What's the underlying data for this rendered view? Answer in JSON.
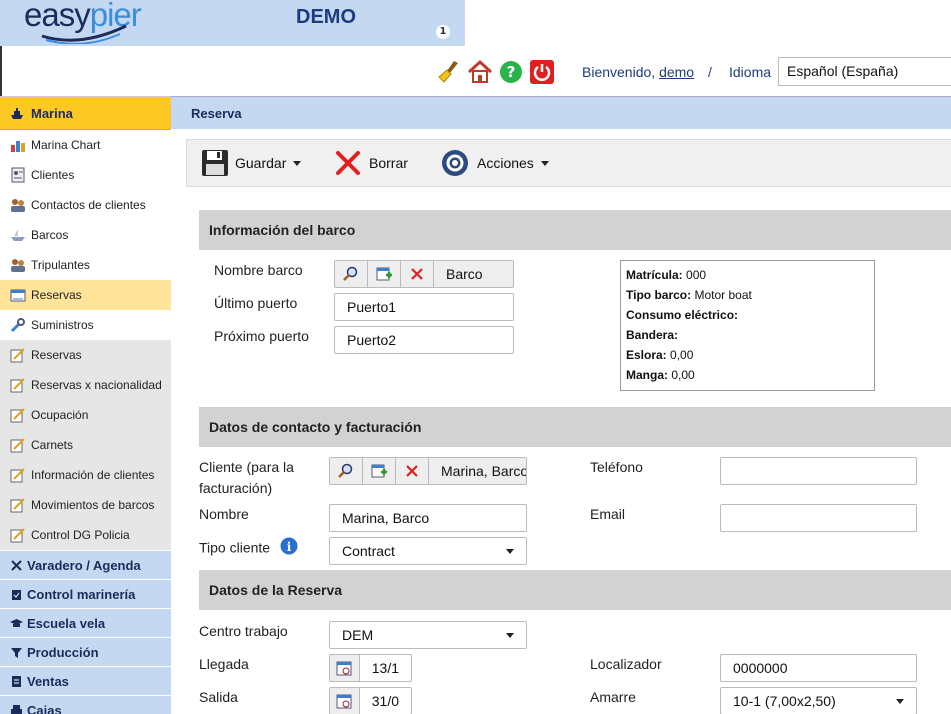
{
  "header": {
    "logo_easy": "easy",
    "logo_pier": "pier",
    "title": "DEMO",
    "notification_count": "1",
    "welcome_text": "Bienvenido, ",
    "username": "demo",
    "separator": "/",
    "language_label": "Idioma",
    "language_value": "Español (España)"
  },
  "sidebar": {
    "head": "Marina",
    "items": [
      {
        "label": "Marina Chart",
        "icon": "chart-icon"
      },
      {
        "label": "Clientes",
        "icon": "clients-icon"
      },
      {
        "label": "Contactos de clientes",
        "icon": "contacts-icon"
      },
      {
        "label": "Barcos",
        "icon": "boat-icon"
      },
      {
        "label": "Tripulantes",
        "icon": "crew-icon"
      },
      {
        "label": "Reservas",
        "icon": "reservations-icon"
      },
      {
        "label": "Suministros",
        "icon": "supplies-icon"
      }
    ],
    "reports": [
      {
        "label": "Reservas"
      },
      {
        "label": "Reservas x nacionalidad"
      },
      {
        "label": "Ocupación"
      },
      {
        "label": "Carnets"
      },
      {
        "label": "Información de clientes"
      },
      {
        "label": "Movimientos de barcos"
      },
      {
        "label": "Control DG Policia"
      }
    ],
    "groups": [
      {
        "label": "Varadero / Agenda",
        "icon": "tools-icon"
      },
      {
        "label": "Control marinería",
        "icon": "clipboard-icon"
      },
      {
        "label": "Escuela vela",
        "icon": "graduation-icon"
      },
      {
        "label": "Producción",
        "icon": "filter-icon"
      },
      {
        "label": "Ventas",
        "icon": "document-icon"
      },
      {
        "label": "Cajas",
        "icon": "register-icon"
      }
    ]
  },
  "tab": {
    "label": "Reserva"
  },
  "toolbar": {
    "save_label": "Guardar",
    "delete_label": "Borrar",
    "actions_label": "Acciones"
  },
  "boat_section": {
    "title": "Información del barco",
    "boat_name_label": "Nombre barco",
    "boat_name_value": "Barco",
    "last_port_label": "Último puerto",
    "last_port_value": "Puerto1",
    "next_port_label": "Próximo puerto",
    "next_port_value": "Puerto2",
    "info": {
      "registration_label": "Matrícula:",
      "registration_value": "000",
      "type_label": "Tipo barco:",
      "type_value": "Motor boat",
      "power_label": "Consumo eléctrico:",
      "power_value": "",
      "flag_label": "Bandera:",
      "flag_value": "",
      "beam_label": "Eslora:",
      "beam_value": "0,00",
      "length_label": "Manga:",
      "length_value": "0,00"
    }
  },
  "contact_section": {
    "title": "Datos de contacto y facturación",
    "client_label": "Cliente (para la facturación)",
    "client_value": "Marina, Barco",
    "phone_label": "Teléfono",
    "phone_value": "",
    "name_label": "Nombre",
    "name_value": "Marina, Barco",
    "email_label": "Email",
    "email_value": "",
    "client_type_label": "Tipo cliente",
    "client_type_value": "Contract"
  },
  "reservation_section": {
    "title": "Datos de la Reserva",
    "work_center_label": "Centro trabajo",
    "work_center_value": "DEM",
    "arrival_label": "Llegada",
    "arrival_value": "13/1",
    "locator_label": "Localizador",
    "locator_value": "0000000",
    "departure_label": "Salida",
    "departure_value": "31/0",
    "berth_label": "Amarre",
    "berth_value": "10-1 (7,00x2,50)"
  }
}
